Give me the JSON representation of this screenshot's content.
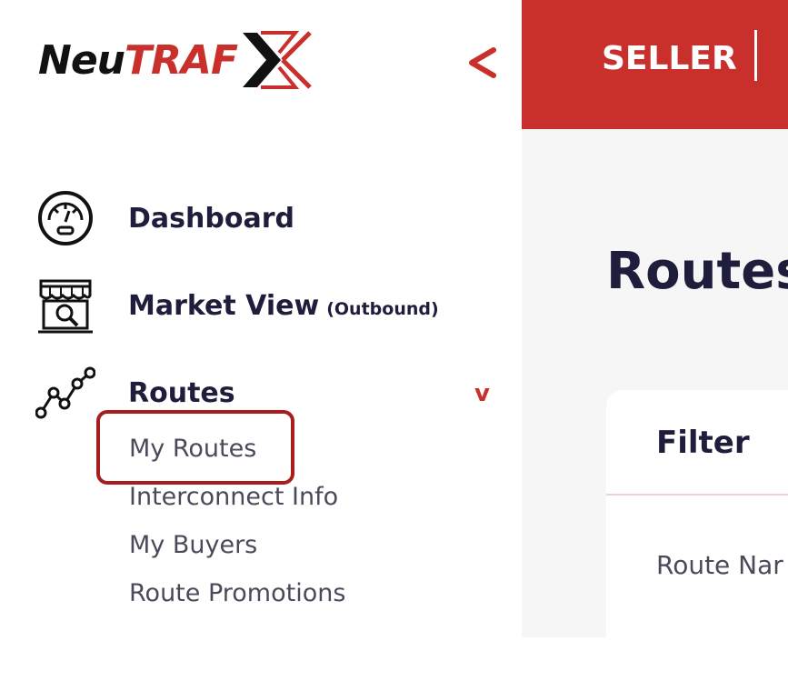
{
  "brand": {
    "logo_part1": "Neu",
    "logo_part2": "TRAF",
    "logo_mark": "X"
  },
  "sidebar": {
    "collapse_icon": "chevron-left-icon",
    "items": [
      {
        "label": "Dashboard",
        "icon": "speedometer-icon"
      },
      {
        "label": "Market View",
        "sublabel": "(Outbound)",
        "icon": "market-store-icon"
      },
      {
        "label": "Routes",
        "icon": "routes-graph-icon",
        "expanded": true
      }
    ],
    "routes_submenu": [
      "My Routes",
      "Interconnect Info",
      "My Buyers",
      "Route Promotions"
    ]
  },
  "topbar": {
    "role": "SELLER"
  },
  "main": {
    "page_title": "Routes",
    "filter": {
      "title": "Filter",
      "route_name_label": "Route Nar"
    }
  },
  "colors": {
    "accent": "#c9302c",
    "text_dark": "#1e1e3c",
    "highlight": "#a81d1d"
  }
}
